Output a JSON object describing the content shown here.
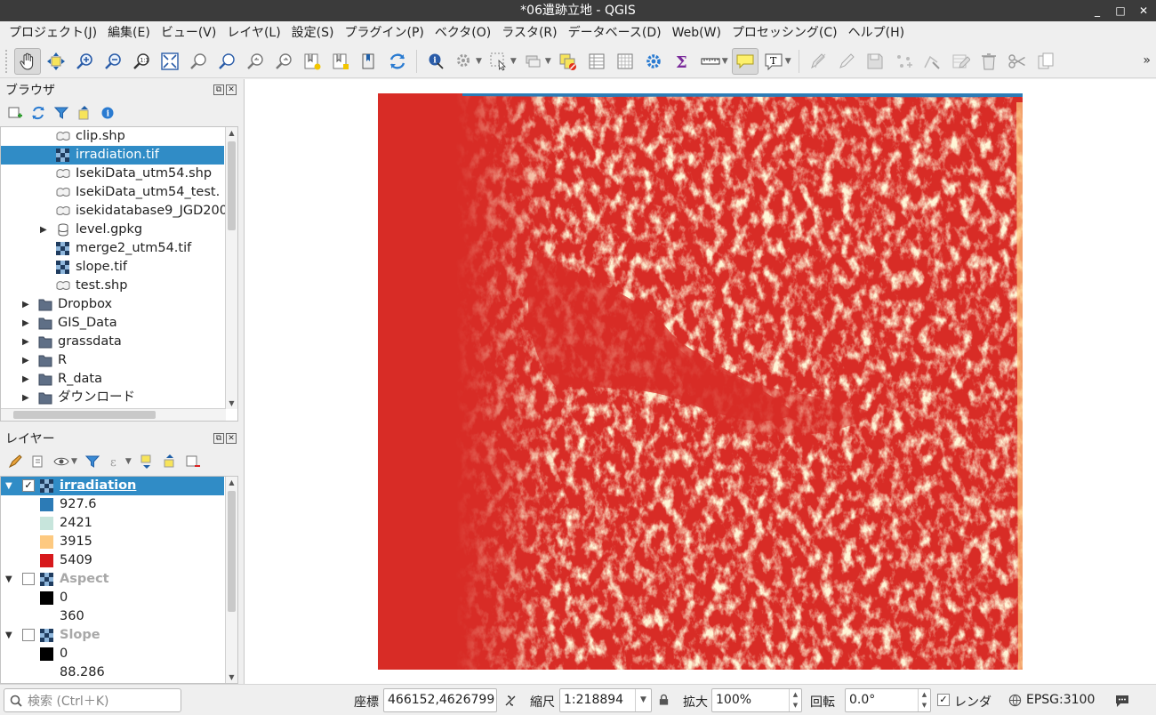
{
  "window": {
    "title": "*06遺跡立地 - QGIS",
    "controls": [
      "_",
      "□",
      "✕"
    ]
  },
  "menu": [
    "プロジェクト(J)",
    "編集(E)",
    "ビュー(V)",
    "レイヤ(L)",
    "設定(S)",
    "プラグイン(P)",
    "ベクタ(O)",
    "ラスタ(R)",
    "データベース(D)",
    "Web(W)",
    "プロセッシング(C)",
    "ヘルプ(H)"
  ],
  "toolbar": {
    "more": "»"
  },
  "browser": {
    "title": "ブラウザ",
    "items": [
      {
        "label": "clip.shp",
        "type": "vector",
        "level": 2
      },
      {
        "label": "irradiation.tif",
        "type": "raster",
        "level": 2,
        "selected": true
      },
      {
        "label": "IsekiData_utm54.shp",
        "type": "vector",
        "level": 2
      },
      {
        "label": "IsekiData_utm54_test.",
        "type": "vector",
        "level": 2
      },
      {
        "label": "isekidatabase9_JGD200",
        "type": "vector",
        "level": 2
      },
      {
        "label": "level.gpkg",
        "type": "gpkg",
        "level": 2,
        "expandable": true
      },
      {
        "label": "merge2_utm54.tif",
        "type": "raster",
        "level": 2
      },
      {
        "label": "slope.tif",
        "type": "raster",
        "level": 2
      },
      {
        "label": "test.shp",
        "type": "vector",
        "level": 2
      },
      {
        "label": "Dropbox",
        "type": "folder",
        "level": 1,
        "expandable": true
      },
      {
        "label": "GIS_Data",
        "type": "folder",
        "level": 1,
        "expandable": true
      },
      {
        "label": "grassdata",
        "type": "folder",
        "level": 1,
        "expandable": true
      },
      {
        "label": "R",
        "type": "folder",
        "level": 1,
        "expandable": true
      },
      {
        "label": "R_data",
        "type": "folder",
        "level": 1,
        "expandable": true
      },
      {
        "label": "ダウンロード",
        "type": "folder",
        "level": 1,
        "expandable": true
      }
    ]
  },
  "layers": {
    "title": "レイヤー",
    "items": [
      {
        "kind": "layer",
        "label": "irradiation",
        "checked": true,
        "selected": true
      },
      {
        "kind": "legend",
        "label": "927.6",
        "color": "#2c7bb6"
      },
      {
        "kind": "legend",
        "label": "2421",
        "color": "#c7e5dc"
      },
      {
        "kind": "legend",
        "label": "3915",
        "color": "#fdc980"
      },
      {
        "kind": "legend",
        "label": "5409",
        "color": "#d7191c"
      },
      {
        "kind": "layer",
        "label": "Aspect",
        "checked": false
      },
      {
        "kind": "legend",
        "label": "0",
        "color": "#000000"
      },
      {
        "kind": "legend",
        "label": "360",
        "color": ""
      },
      {
        "kind": "layer",
        "label": "Slope",
        "checked": false
      },
      {
        "kind": "legend",
        "label": "0",
        "color": "#000000"
      },
      {
        "kind": "legend",
        "label": "88.286",
        "color": ""
      }
    ]
  },
  "status": {
    "locator_placeholder": "検索 (Ctrl＋K)",
    "coord_label": "座標",
    "coord_value": "466152,4626799",
    "scale_label": "縮尺",
    "scale_value": "1:218894",
    "magnifier_label": "拡大",
    "magnifier_value": "100%",
    "rotation_label": "回転",
    "rotation_value": "0.0°",
    "render_label": "レンダ",
    "render_checked": true,
    "crs": "EPSG:3100"
  },
  "colors": {
    "accent": "#308cc6",
    "raster_low": "#2c7bb6",
    "raster_high": "#d7191c"
  }
}
